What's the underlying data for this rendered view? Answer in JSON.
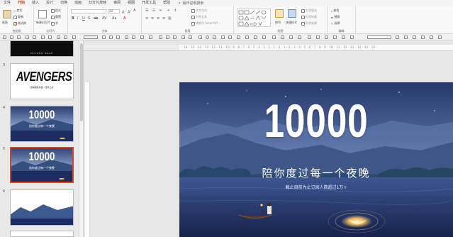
{
  "menu": {
    "items": [
      "文件",
      "开始",
      "插入",
      "设计",
      "切换",
      "动画",
      "幻灯片放映",
      "审阅",
      "视图",
      "开发工具",
      "帮助"
    ],
    "active_index": 1,
    "search_placeholder": "操作说明搜索"
  },
  "ribbon": {
    "clipboard": {
      "paste": "粘贴",
      "cut": "剪切",
      "copy": "复制",
      "format_painter": "格式刷",
      "group": "剪贴板"
    },
    "slides": {
      "new_slide": "新建幻灯片",
      "layout": "版式",
      "reset": "重置",
      "section": "节",
      "group": "幻灯片"
    },
    "font": {
      "size": "28",
      "group": "字体"
    },
    "paragraph": {
      "text_direction": "文字方向",
      "align_text": "对齐文本",
      "smartart": "转换为 SmartArt",
      "group": "段落"
    },
    "drawing": {
      "arrange": "排列",
      "quick_styles": "快速样式",
      "shape_fill": "形状填充",
      "shape_outline": "形状轮廓",
      "shape_effects": "形状效果",
      "group": "绘图"
    },
    "editing": {
      "find": "查找",
      "replace": "替换",
      "select": "选择",
      "group": "编辑"
    }
  },
  "ruler": {
    "numbers": "· 16 · 15 · 14 · 13 · 12 · 11 · 10 · 9 · 8 · 7 · 6 · 5 · 4 · 3 · 2 · 1 · 0 · 1 · 2 · 3 · 4 · 5 · 6 · 7 · 8 · 9 · 10 · 11 · 12 · 13 · 14 · 15 · 16 ·"
  },
  "thumbnails": [
    {
      "number": "",
      "caption": "SECOND PAGE"
    },
    {
      "number": "3",
      "title": "AVENGERS",
      "subtitle": "漫威超级英雄 · 终局之战"
    },
    {
      "number": "4",
      "big_number": "10000",
      "tagline": "陪你度过每一个夜晚"
    },
    {
      "number": "5",
      "big_number": "10000",
      "tagline": "陪你度过每一个夜晚",
      "selected": true
    },
    {
      "number": "6"
    }
  ],
  "slide": {
    "big_number": "10000",
    "tagline": "陪你度过每一个夜晚",
    "subline": "截止目前为止订阅人数超过1万+"
  },
  "colors": {
    "accent": "#d24726",
    "sky_top": "#2c3f72",
    "sky_bottom": "#8fa7cf",
    "water": "#1d2c60",
    "moon": "#ffc15a"
  }
}
